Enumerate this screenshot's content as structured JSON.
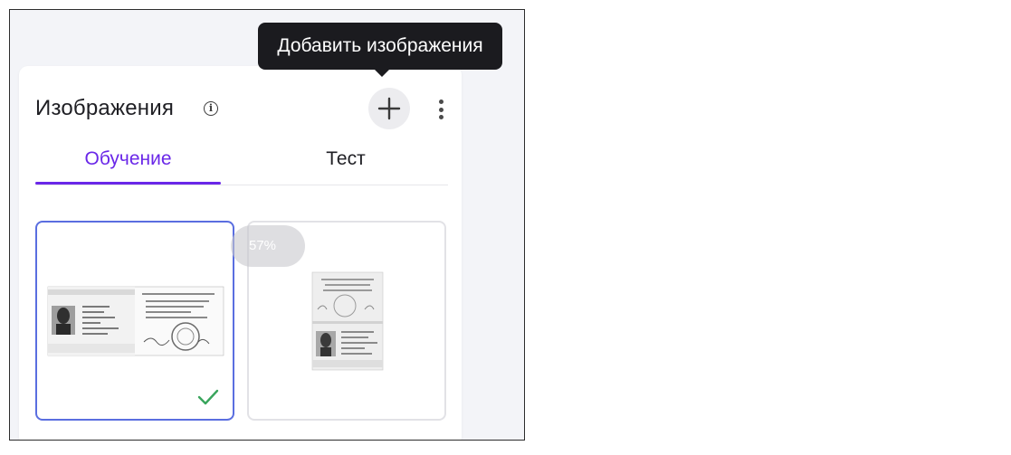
{
  "card": {
    "title": "Изображения",
    "info_glyph": "i",
    "add_icon": "plus-icon",
    "more_icon": "more-vertical-icon"
  },
  "tabs": [
    {
      "label": "Обучение",
      "active": true
    },
    {
      "label": "Тест",
      "active": false
    }
  ],
  "images": [
    {
      "name": "passport-spread-1",
      "selected": true,
      "status_icon": "check-icon",
      "status_color": "#3aa55d"
    },
    {
      "name": "passport-spread-2",
      "selected": false,
      "upload_progress": "57%"
    }
  ],
  "tooltip": {
    "text": "Добавить изображения"
  },
  "colors": {
    "accent": "#6a27e8",
    "selected_border": "#5a6ee0",
    "tooltip_bg": "#1b1b1f"
  }
}
